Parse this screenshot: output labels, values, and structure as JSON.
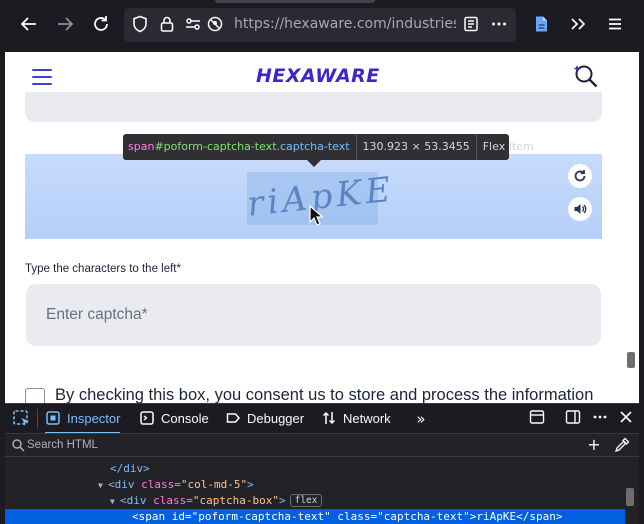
{
  "browser": {
    "url": "https://hexaware.com/industries/ed",
    "icons": [
      "back-icon",
      "forward-icon",
      "reload-icon",
      "shield-icon",
      "lock-icon",
      "tracking-permission-icon",
      "microphone-blocked-icon",
      "reader-view-icon",
      "more-icon",
      "extension-icon",
      "overflow-chevron-icon",
      "app-menu-icon"
    ]
  },
  "page": {
    "logo": "HEXAWARE",
    "brand_color": "#3d27c8",
    "tooltip": {
      "tag": "span",
      "id": "#poform-captcha-text",
      "class": ".captcha-text",
      "size": "130.923 × 53.3455",
      "badge": "Flex Item"
    },
    "captcha_text": "riApKE",
    "captcha_label": "Type the characters to the left*",
    "captcha_placeholder": "Enter captcha*",
    "consent_text": "By checking this box, you consent us to store and process the information"
  },
  "devtools": {
    "tabs": [
      {
        "label": "Inspector",
        "icon": "inspector-icon",
        "active": true
      },
      {
        "label": "Console",
        "icon": "console-icon",
        "active": false
      },
      {
        "label": "Debugger",
        "icon": "debugger-icon",
        "active": false
      },
      {
        "label": "Network",
        "icon": "network-icon",
        "active": false
      }
    ],
    "search_placeholder": "Search HTML",
    "markup": {
      "line1_tag": "</div>",
      "line2_open": "<div",
      "line2_attr": "class",
      "line2_val": "\"col-md-5\"",
      "line2_close": ">",
      "line3_open": "<div",
      "line3_attr": "class",
      "line3_val": "\"captcha-box\"",
      "line3_close": ">",
      "line3_badge": "flex",
      "line4_open": "<span",
      "line4_attr1": "id",
      "line4_val1": "\"poform-captcha-text\"",
      "line4_attr2": "class",
      "line4_val2": "\"captcha-text\"",
      "line4_close": ">riApKE</span>"
    },
    "accent_color": "#75bfff",
    "selection_color": "#0060df"
  }
}
